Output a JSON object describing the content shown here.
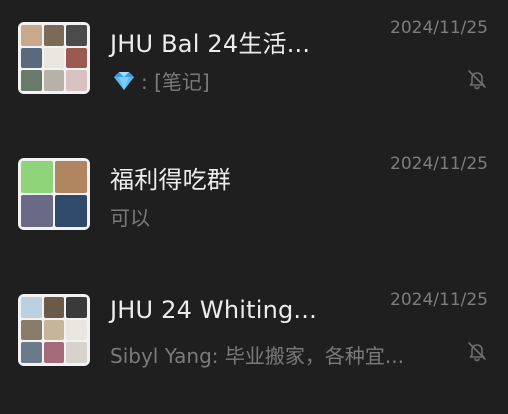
{
  "chats": [
    {
      "title": "JHU Bal 24生活...",
      "date": "2024/11/25",
      "preview_prefix_icon": "gem-icon",
      "preview": ": [笔记]",
      "muted": true,
      "avatar_tiles": [
        "#c9a98b",
        "#7b6a58",
        "#4b4b4b",
        "#5a6a7e",
        "#e9e6df",
        "#9a5a50",
        "#6a7a6a",
        "#b7b1a8",
        "#d9c2c2"
      ]
    },
    {
      "title": "福利得吃群",
      "date": "2024/11/25",
      "preview": "可以",
      "muted": false,
      "avatar_tiles": [
        "#8fd37a",
        "#b08660",
        "#6a6a86",
        "#2f4a6a"
      ]
    },
    {
      "title": "JHU 24 Whiting...",
      "date": "2024/11/25",
      "preview": "Sibyl Yang: 毕业搬家，各种宜...",
      "muted": true,
      "avatar_tiles": [
        "#bcd0e0",
        "#6a5a4a",
        "#3a3a3a",
        "#8a7a6a",
        "#c7b59a",
        "#e9e6df",
        "#6a7a8a",
        "#a46a7a",
        "#d7d2cc"
      ]
    }
  ],
  "colors": {
    "background": "#1f1f1f",
    "title": "#ececec",
    "secondary": "#7d7d7d",
    "gem": "#5ab8f0"
  }
}
